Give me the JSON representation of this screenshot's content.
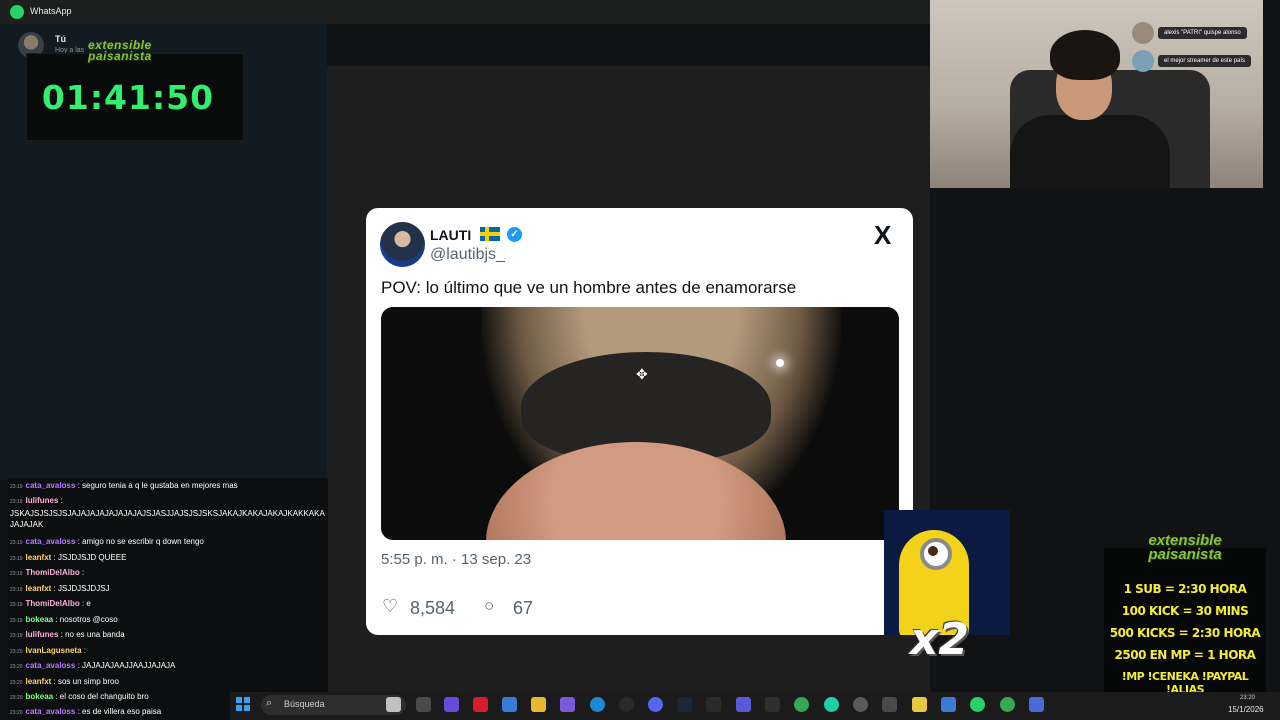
{
  "app": {
    "title": "WhatsApp",
    "contact_name": "Tú",
    "contact_sub": "Hoy a las"
  },
  "timer": {
    "logo_line1": "extensible",
    "logo_line2": "paisanista",
    "value": "01:41:50"
  },
  "tweet": {
    "display_name": "LAUTI",
    "handle": "@lautibjs_",
    "verified_mark": "✓",
    "x_logo": "X",
    "text": "POV: lo último que ve un hombre antes de enamorarse",
    "timestamp": "5:55 p. m. · 13 sep. 23",
    "likes": "8,584",
    "replies": "67",
    "like_icon": "♡",
    "reply_icon": "○"
  },
  "sticker": {
    "multiplier": "x2"
  },
  "webcam_chat": [
    {
      "text": "alexis \"PATRI\" quispe alonso"
    },
    {
      "text": "el mejor streamer de este país"
    }
  ],
  "info_panel": {
    "logo_line1": "extensible",
    "logo_line2": "paisanista",
    "lines": [
      "1 SUB = 2:30 HORA",
      "100 KICK = 30 MINS",
      "500 KICKS = 2:30 HORA",
      "2500 EN MP = 1 HORA",
      "!MP !CENEKA !PAYPAL !ALIAS"
    ]
  },
  "chat": [
    {
      "ts": "23:19",
      "user": "cata_avaloss",
      "color": "#b47cff",
      "msg": "seguro tenia a q le gustaba en mejores      mas"
    },
    {
      "ts": "23:19",
      "user": "lulifunes",
      "color": "#ffb0e0",
      "msg": "JSKAJSJSJSJSJAJAJAJAJAJAJAJAJSJASJJAJSJSJSKSJAKAJKAKAJAKAJKAKKAKAJAJAJAK"
    },
    {
      "ts": "23:19",
      "user": "cata_avaloss",
      "color": "#b47cff",
      "msg": "amigo no se escribir q down tengo"
    },
    {
      "ts": "23:19",
      "user": "leanfxt",
      "color": "#ffd36e",
      "msg": "JSJDJSJD QUEEE"
    },
    {
      "ts": "23:19",
      "user": "ThomiDelAlbo",
      "color": "#ffb0e0",
      "msg": ""
    },
    {
      "ts": "23:19",
      "user": "leanfxt",
      "color": "#ffd36e",
      "msg": "JSJDJSJDJSJ"
    },
    {
      "ts": "23:19",
      "user": "ThomiDelAlbo",
      "color": "#ffb0e0",
      "msg": "e"
    },
    {
      "ts": "23:19",
      "user": "bokeaa",
      "color": "#7cff8a",
      "msg": "nosotros @coso"
    },
    {
      "ts": "23:19",
      "user": "lulifunes",
      "color": "#ffb0e0",
      "msg": "no es una banda"
    },
    {
      "ts": "23:20",
      "user": "IvanLagusneta",
      "color": "#ffd36e",
      "msg": ""
    },
    {
      "ts": "23:20",
      "user": "cata_avaloss",
      "color": "#b47cff",
      "msg": "JAJAJAJAAJJAAJJAJAJA"
    },
    {
      "ts": "23:20",
      "user": "leanfxt",
      "color": "#ffd36e",
      "msg": "sos un simp broo"
    },
    {
      "ts": "23:20",
      "user": "bokeaa",
      "color": "#7cff8a",
      "msg": "el coso del changuito bro"
    },
    {
      "ts": "23:20",
      "user": "cata_avaloss",
      "color": "#b47cff",
      "msg": "es de villera eso paisa"
    }
  ],
  "taskbar": {
    "search_label": "Búsqueda",
    "time": "23:20",
    "date": "15/1/2026"
  },
  "colors": {
    "timer_green": "#31f06e",
    "info_yellow": "#f4ec3a",
    "twitter_blue": "#1d9bf0",
    "whatsapp_green": "#25d366"
  }
}
